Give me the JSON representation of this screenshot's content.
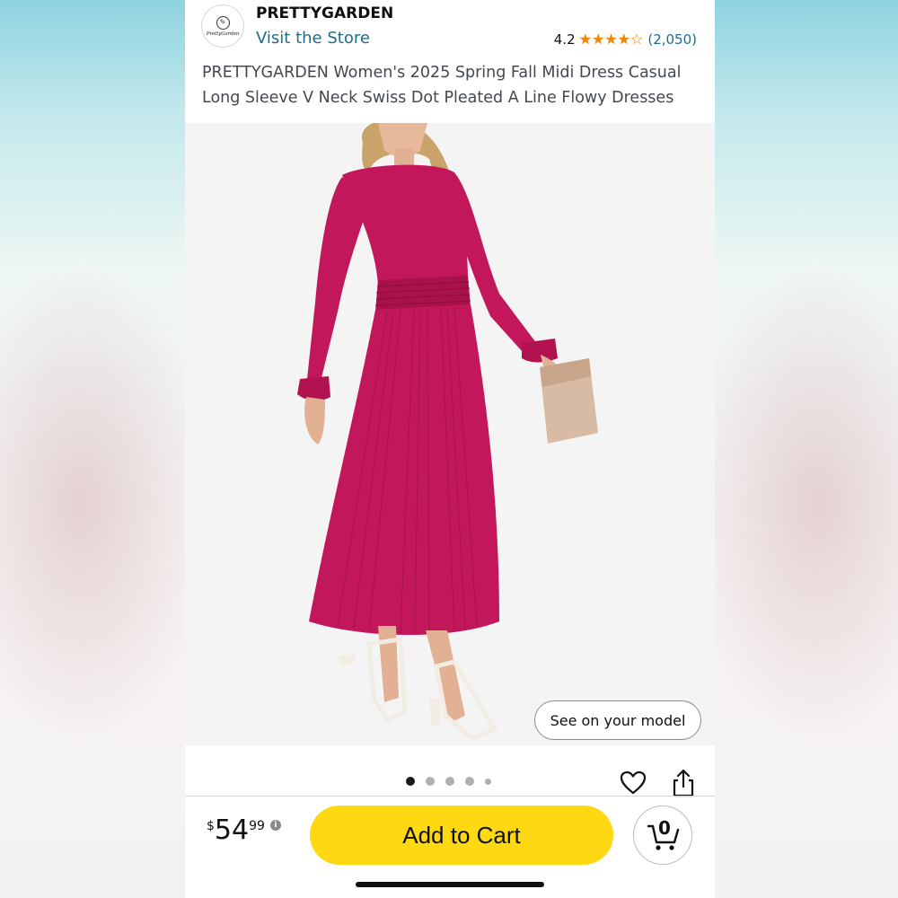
{
  "store": {
    "brand_name": "PRETTYGARDEN",
    "visit_store_label": "Visit the Store",
    "logo_text": "PrettyGarden"
  },
  "rating": {
    "value": "4.2",
    "review_count": "(2,050)",
    "stars_fraction": 0.84,
    "star_color": "#f08804"
  },
  "product": {
    "title": "PRETTYGARDEN Women's 2025 Spring Fall Midi Dress Casual Long Sleeve V Neck Swiss Dot Pleated A Line Flowy Dresses",
    "image_description_icon": "dress-photo",
    "dress_color": "#c2185b"
  },
  "image_actions": {
    "see_on_model_label": "See on your model",
    "carousel_dots": 5,
    "active_dot": 1
  },
  "icons": {
    "favorite": "heart-icon",
    "share": "share-icon",
    "cart": "cart-icon",
    "info": "info-icon"
  },
  "buy_bar": {
    "price_symbol": "$",
    "price_whole": "54",
    "price_fraction": "99",
    "add_to_cart_label": "Add to Cart",
    "add_to_cart_color": "#ffd814",
    "cart_count": "0"
  }
}
